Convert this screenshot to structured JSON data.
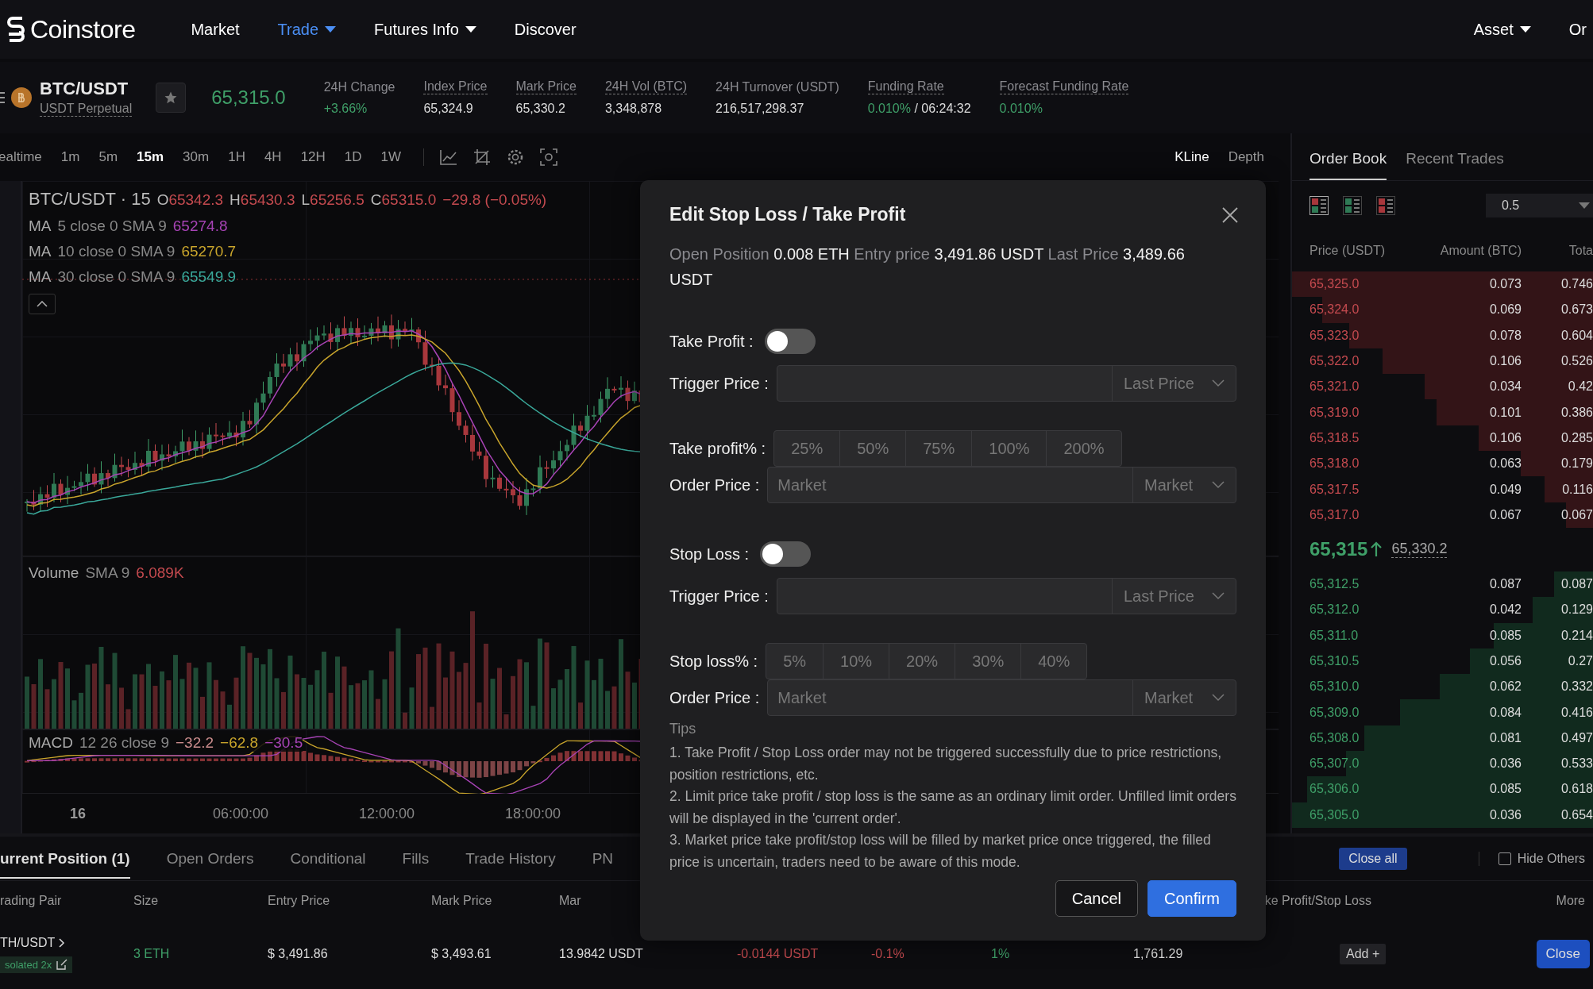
{
  "nav": {
    "logo": "Coinstore",
    "items": [
      {
        "label": "Market",
        "selected": false,
        "has_menu": false
      },
      {
        "label": "Trade",
        "selected": true,
        "has_menu": true
      },
      {
        "label": "Futures Info",
        "selected": false,
        "has_menu": true
      },
      {
        "label": "Discover",
        "selected": false,
        "has_menu": false
      }
    ],
    "right": [
      {
        "label": "Asset",
        "has_menu": true
      },
      {
        "label": "Or",
        "has_menu": false
      }
    ]
  },
  "ticker": {
    "symbol": "BTC/USDT",
    "contract": "USDT Perpetual",
    "price": "65,315.0",
    "stats": [
      {
        "label": "24H Change",
        "value": "+3.66%",
        "color": "#3f9f68",
        "dotted": false
      },
      {
        "label": "Index Price",
        "value": "65,324.9",
        "color": "#dddddd",
        "dotted": true
      },
      {
        "label": "Mark Price",
        "value": "65,330.2",
        "color": "#dddddd",
        "dotted": true
      },
      {
        "label": "24H Vol (BTC)",
        "value": "3,348,878",
        "color": "#dddddd",
        "dotted": true
      },
      {
        "label": "24H Turnover (USDT)",
        "value": "216,517,298.37",
        "color": "#dddddd",
        "dotted": false
      },
      {
        "label": "Funding Rate",
        "value": "0.010%",
        "extra": "/ 06:24:32",
        "color": "#3f9f68",
        "dotted": true
      },
      {
        "label": "Forecast Funding Rate",
        "value": "0.010%",
        "color": "#3f9f68",
        "dotted": true
      }
    ]
  },
  "chart_toolbar": {
    "intervals": [
      {
        "label": "ealtime",
        "selected": false
      },
      {
        "label": "1m",
        "selected": false
      },
      {
        "label": "5m",
        "selected": false
      },
      {
        "label": "15m",
        "selected": true
      },
      {
        "label": "30m",
        "selected": false
      },
      {
        "label": "1H",
        "selected": false
      },
      {
        "label": "4H",
        "selected": false
      },
      {
        "label": "12H",
        "selected": false
      },
      {
        "label": "1D",
        "selected": false
      },
      {
        "label": "1W",
        "selected": false
      }
    ],
    "views": [
      {
        "label": "KLine",
        "selected": true
      },
      {
        "label": "Depth",
        "selected": false
      }
    ]
  },
  "chart": {
    "title": "BTC/USDT · 15",
    "ohlc": [
      {
        "label": "O",
        "value": "65342.3"
      },
      {
        "label": "H",
        "value": "65430.3"
      },
      {
        "label": "L",
        "value": "65256.5"
      },
      {
        "label": "C",
        "value": "65315.0"
      }
    ],
    "change": "−29.8 (−0.05%)",
    "mas": [
      {
        "name": "MA",
        "params": "5 close 0 SMA 9",
        "value": "65274.8",
        "color": "#a743b5"
      },
      {
        "name": "MA",
        "params": "10 close 0 SMA 9",
        "value": "65270.7",
        "color": "#c9a52c"
      },
      {
        "name": "MA",
        "params": "30 close 0 SMA 9",
        "value": "65549.9",
        "color": "#3aa89a"
      }
    ],
    "volume": {
      "name": "Volume",
      "params": "SMA 9",
      "value": "6.089K"
    },
    "macd": {
      "name": "MACD",
      "params": "12 26 close 9",
      "values": [
        {
          "text": "−32.2",
          "color": "#c98c8c"
        },
        {
          "text": "−62.8",
          "color": "#c9a52c"
        },
        {
          "text": "−30.5",
          "color": "#a743b5"
        }
      ]
    },
    "time_axis": [
      "16",
      "06:00:00",
      "12:00:00",
      "18:00:00"
    ]
  },
  "order_book": {
    "tabs": [
      {
        "label": "Order Book",
        "selected": true
      },
      {
        "label": "Recent Trades",
        "selected": false
      }
    ],
    "step": "0.5",
    "columns": [
      "Price (USDT)",
      "Amount (BTC)",
      "Tota"
    ],
    "asks": [
      {
        "price": "65,325.0",
        "amount": "0.073",
        "total": "0.746",
        "level": 1.0
      },
      {
        "price": "65,324.0",
        "amount": "0.069",
        "total": "0.673",
        "level": 0.9
      },
      {
        "price": "65,323.0",
        "amount": "0.078",
        "total": "0.604",
        "level": 0.81
      },
      {
        "price": "65,322.0",
        "amount": "0.106",
        "total": "0.526",
        "level": 0.7
      },
      {
        "price": "65,321.0",
        "amount": "0.034",
        "total": "0.42",
        "level": 0.56
      },
      {
        "price": "65,319.0",
        "amount": "0.101",
        "total": "0.386",
        "level": 0.52
      },
      {
        "price": "65,318.5",
        "amount": "0.106",
        "total": "0.285",
        "level": 0.38
      },
      {
        "price": "65,318.0",
        "amount": "0.063",
        "total": "0.179",
        "level": 0.24
      },
      {
        "price": "65,317.5",
        "amount": "0.049",
        "total": "0.116",
        "level": 0.16
      },
      {
        "price": "65,317.0",
        "amount": "0.067",
        "total": "0.067",
        "level": 0.09
      }
    ],
    "last_price": "65,315",
    "mark_price": "65,330.2",
    "bids": [
      {
        "price": "65,312.5",
        "amount": "0.087",
        "total": "0.087",
        "level": 0.13
      },
      {
        "price": "65,312.0",
        "amount": "0.042",
        "total": "0.129",
        "level": 0.2
      },
      {
        "price": "65,311.0",
        "amount": "0.085",
        "total": "0.214",
        "level": 0.33
      },
      {
        "price": "65,310.5",
        "amount": "0.056",
        "total": "0.27",
        "level": 0.41
      },
      {
        "price": "65,310.0",
        "amount": "0.062",
        "total": "0.332",
        "level": 0.51
      },
      {
        "price": "65,309.0",
        "amount": "0.084",
        "total": "0.416",
        "level": 0.64
      },
      {
        "price": "65,308.0",
        "amount": "0.081",
        "total": "0.497",
        "level": 0.76
      },
      {
        "price": "65,307.0",
        "amount": "0.036",
        "total": "0.533",
        "level": 0.82
      },
      {
        "price": "65,306.0",
        "amount": "0.085",
        "total": "0.618",
        "level": 0.95
      },
      {
        "price": "65,305.0",
        "amount": "0.036",
        "total": "0.654",
        "level": 1.0
      }
    ]
  },
  "positions": {
    "tabs": [
      {
        "label": "urrent Position (1)",
        "selected": true
      },
      {
        "label": "Open Orders",
        "selected": false
      },
      {
        "label": "Conditional",
        "selected": false
      },
      {
        "label": "Fills",
        "selected": false
      },
      {
        "label": "Trade History",
        "selected": false
      },
      {
        "label": "PN",
        "selected": false
      }
    ],
    "close_all": "Close all",
    "hide_others": {
      "label": "Hide Others",
      "checked": false
    },
    "columns": [
      "rading Pair",
      "Size",
      "Entry Price",
      "Mark Price",
      "Mar",
      "ke Profit/Stop Loss",
      "More"
    ],
    "row": {
      "pair": "TH/USDT",
      "margin_mode": "solated 2x",
      "size": "3 ETH",
      "entry": "$ 3,491.86",
      "mark": "$ 3,493.61",
      "margin": "13.9842 USDT",
      "pnl": "-0.0144 USDT",
      "roe": "-0.1%",
      "column_8": "1%",
      "column_9": "1,761.29",
      "add": "Add +",
      "close": "Close"
    }
  },
  "modal": {
    "title": "Edit Stop Loss / Take Profit",
    "info": "Open Position **0.008 ETH** Entry price **3,491.86 USDT** Last Price **3,489.66 USDT**",
    "sections": [
      {
        "label": "Take Profit :",
        "on": false,
        "trigger": {
          "label": "Trigger Price :",
          "select": "Last Price"
        },
        "percent": {
          "label": "Take profit% :",
          "options": [
            "25%",
            "50%",
            "75%",
            "100%",
            "200%"
          ]
        },
        "order": {
          "label": "Order Price :",
          "placeholder": "Market",
          "select": "Market"
        }
      },
      {
        "label": "Stop Loss :",
        "on": false,
        "trigger": {
          "label": "Trigger Price :",
          "select": "Last Price"
        },
        "percent": {
          "label": "Stop loss% :",
          "options": [
            "5%",
            "10%",
            "20%",
            "30%",
            "40%"
          ]
        },
        "order": {
          "label": "Order Price :",
          "placeholder": "Market",
          "select": "Market"
        }
      }
    ],
    "tips_title": "Tips",
    "tips": [
      "1. Take Profit / Stop Loss order may not be triggered successfully due to price restrictions, position restrictions, etc.",
      "2. Limit price take profit / stop loss is the same as an ordinary limit order. Unfilled limit orders will be displayed in the 'current order'.",
      "3. Market price take profit/stop loss will be filled by market price once triggered, the filled price is uncertain, traders need to be aware of this mode."
    ],
    "cancel": "Cancel",
    "confirm": "Confirm"
  }
}
